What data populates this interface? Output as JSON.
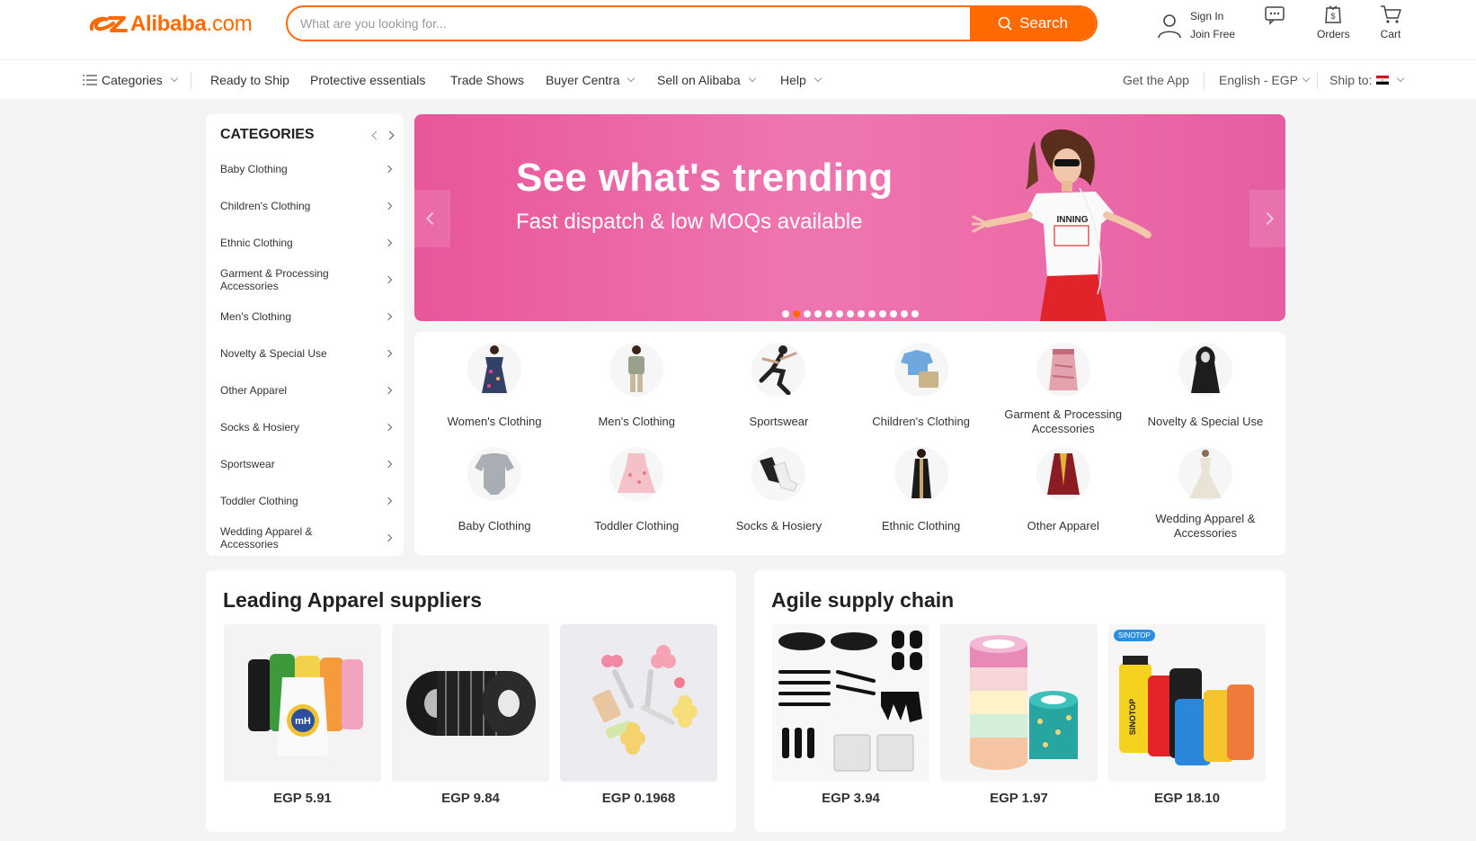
{
  "header": {
    "logo_text": "Alibaba",
    "logo_suffix": ".com",
    "search_placeholder": "What are you looking for...",
    "search_button": "Search",
    "sign_in": "Sign In",
    "join_free": "Join Free",
    "orders": "Orders",
    "cart": "Cart"
  },
  "nav": {
    "categories": "Categories",
    "ready_to_ship": "Ready to Ship",
    "protective": "Protective essentials",
    "trade_shows": "Trade Shows",
    "buyer_central": "Buyer Centra",
    "sell": "Sell on Alibaba",
    "help": "Help",
    "get_app": "Get the App",
    "language": "English - EGP",
    "ship_to": "Ship to:"
  },
  "sidebar": {
    "title": "CATEGORIES",
    "items": [
      "Baby Clothing",
      "Children's Clothing",
      "Ethnic Clothing",
      "Garment & Processing Accessories",
      "Men's Clothing",
      "Novelty & Special Use",
      "Other Apparel",
      "Socks & Hosiery",
      "Sportswear",
      "Toddler Clothing",
      "Wedding Apparel & Accessories"
    ]
  },
  "banner": {
    "title": "See what's trending",
    "subtitle": "Fast dispatch & low MOQs available",
    "shirt_text": "INNING",
    "slide_count": 13,
    "active_slide": 1
  },
  "category_grid": [
    "Women's Clothing",
    "Men's Clothing",
    "Sportswear",
    "Children's Clothing",
    "Garment & Processing Accessories",
    "Novelty & Special Use",
    "Baby Clothing",
    "Toddler Clothing",
    "Socks & Hosiery",
    "Ethnic Clothing",
    "Other Apparel",
    "Wedding Apparel & Accessories"
  ],
  "cards": [
    {
      "title": "Leading Apparel suppliers",
      "products": [
        {
          "price": "EGP 5.91",
          "image": "thread-spools"
        },
        {
          "price": "EGP 9.84",
          "image": "elastic-band-rolls"
        },
        {
          "price": "EGP 0.1968",
          "image": "flower-hair-clips"
        }
      ]
    },
    {
      "title": "Agile supply chain",
      "products": [
        {
          "price": "EGP 3.94",
          "image": "hair-dye-kit"
        },
        {
          "price": "EGP 1.97",
          "image": "washi-tape-rolls"
        },
        {
          "price": "EGP 18.10",
          "image": "dry-bags",
          "badge": "SINOTOP"
        }
      ]
    }
  ],
  "colors": {
    "brand": "#ff6a00",
    "banner_pink": "#e8569a",
    "background": "#f4f4f4"
  }
}
